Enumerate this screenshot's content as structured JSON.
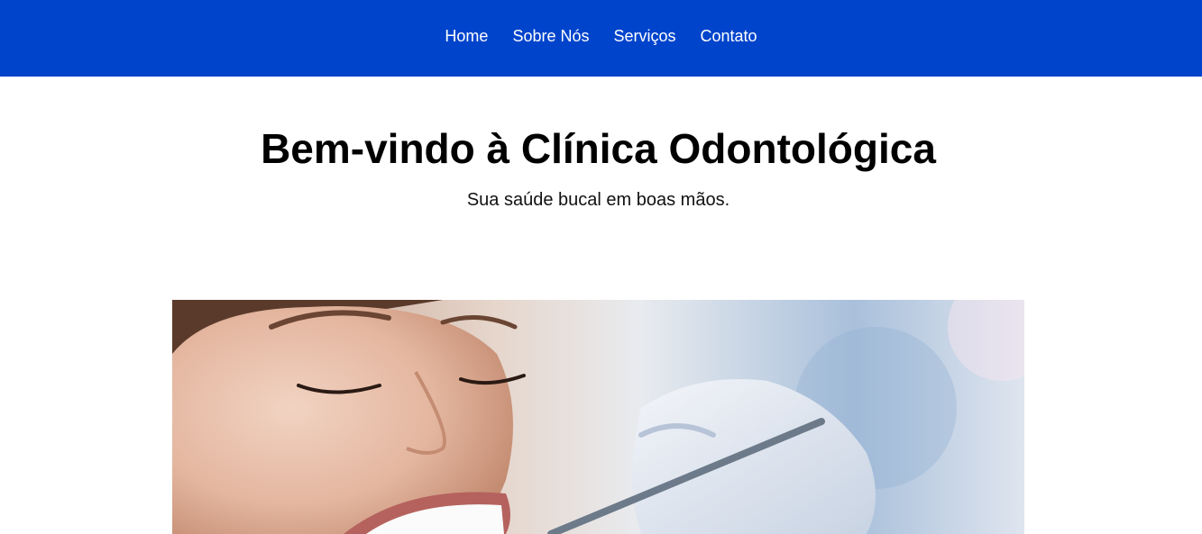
{
  "nav": {
    "items": [
      {
        "label": "Home"
      },
      {
        "label": "Sobre Nós"
      },
      {
        "label": "Serviços"
      },
      {
        "label": "Contato"
      }
    ],
    "background_color": "#0044cc",
    "text_color": "#ffffff"
  },
  "hero": {
    "title": "Bem-vindo à Clínica Odontológica",
    "subtitle": "Sua saúde bucal em boas mãos."
  },
  "photo": {
    "subject": "smiling woman at dental exam with dentist's gloved hand holding a mirror"
  }
}
